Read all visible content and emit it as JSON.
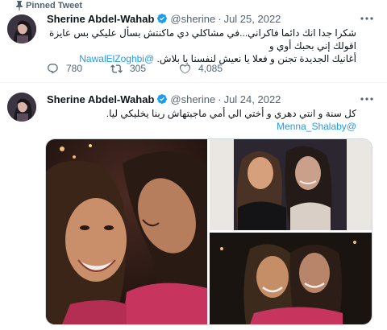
{
  "pinned_label": "Pinned Tweet",
  "tweets": [
    {
      "author_name": "Sherine Abdel-Wahab",
      "handle": "@sherine",
      "separator": "·",
      "date": "Jul 25, 2022",
      "text_line1": "شكرا جدا انك دائما فاكراني...في مشاكلي دي ماكنتش بسأل عليكي بس عايزة اقولك إني بحبك أوي و",
      "text_line2_prefix": "أغانيك الجديدة تجنن و فعلا يا نعيش لنفسنا يا بلاش.",
      "mention": "@NawalElZoghbi",
      "replies": "780",
      "retweets": "305",
      "likes": "4,085"
    },
    {
      "author_name": "Sherine Abdel-Wahab",
      "handle": "@sherine",
      "separator": "·",
      "date": "Jul 24, 2022",
      "text_line1": "كل سنة و انتي دهري و أختي الي أمي ماجبتهاش ربنا   يخليكي ليا.",
      "mention": "@Menna_Shalaby"
    }
  ],
  "colors": {
    "accent": "#1d9bf0",
    "secondary_text": "#536471",
    "divider": "#eff3f4"
  },
  "icons": [
    "pin-icon",
    "verified-badge-icon",
    "more-icon",
    "reply-icon",
    "retweet-icon",
    "like-icon"
  ]
}
